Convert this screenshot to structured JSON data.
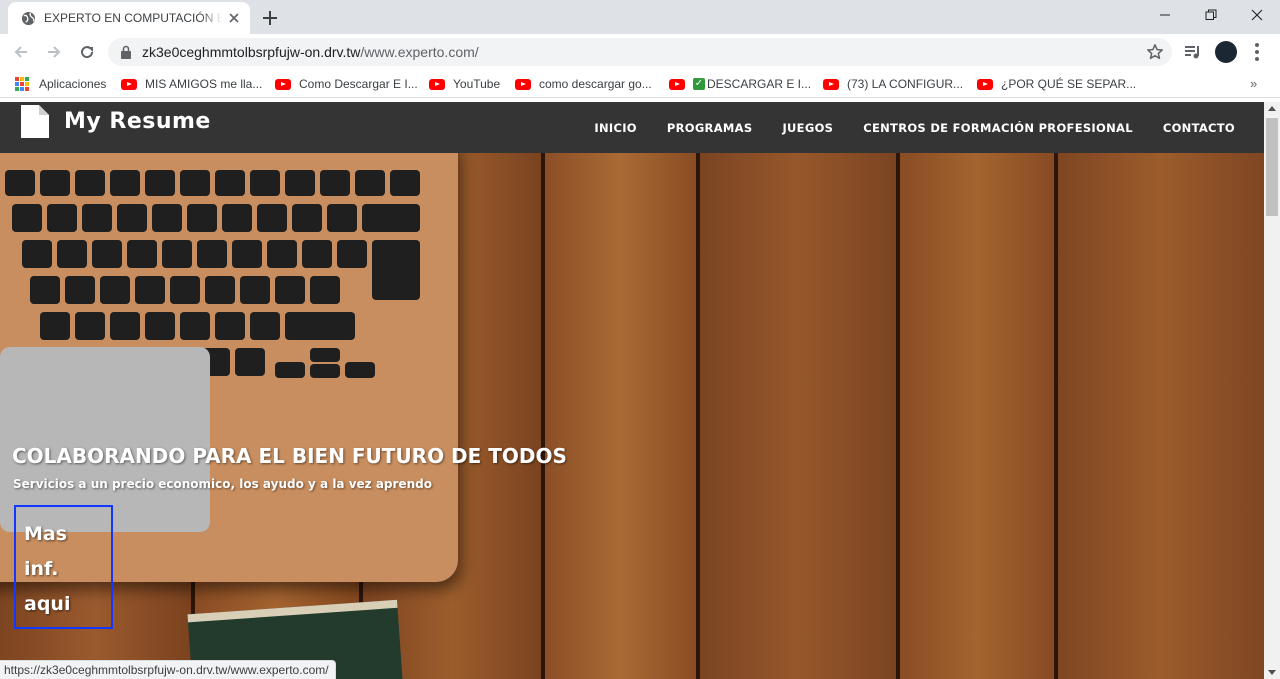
{
  "browser": {
    "tab": {
      "title": "EXPERTO EN COMPUTACIÓN E IN"
    },
    "address": {
      "host": "zk3e0ceghmmtolbsrpfujw-on.drv.tw",
      "path": "/www.experto.com/"
    },
    "bookmarks": [
      {
        "label": "Aplicaciones",
        "icon": "apps-grid-icon"
      },
      {
        "label": "MIS AMIGOS me lla...",
        "icon": "youtube-icon"
      },
      {
        "label": "Como Descargar E I...",
        "icon": "youtube-icon"
      },
      {
        "label": "YouTube",
        "icon": "youtube-icon"
      },
      {
        "label": "como descargar go...",
        "icon": "youtube-icon"
      },
      {
        "label": "DESCARGAR E I...",
        "icon": "youtube-icon"
      },
      {
        "label": "(73) LA CONFIGUR...",
        "icon": "youtube-icon"
      },
      {
        "label": "¿POR QUÉ SE SEPAR...",
        "icon": "youtube-icon"
      }
    ],
    "check_mark": "✓",
    "more_bookmarks": "»",
    "status_url": "https://zk3e0ceghmmtolbsrpfujw-on.drv.tw/www.experto.com/"
  },
  "site": {
    "logo_text": "My Resume",
    "nav": [
      "INICIO",
      "PROGRAMAS",
      "JUEGOS",
      "CENTROS DE FORMACIÓN PROFESIONAL",
      "CONTACTO"
    ],
    "hero": {
      "title": "COLABORANDO PARA EL BIEN FUTURO DE TODOS",
      "subtitle": "Servicios a un precio economico, los ayudo y a la vez aprendo",
      "button_lines": [
        "Mas",
        "inf.",
        "aqui"
      ]
    }
  },
  "colors": {
    "navbar_bg": "#343434",
    "button_border": "#1238ff",
    "wood": "#8a4d25",
    "youtube_red": "#ff0000"
  }
}
